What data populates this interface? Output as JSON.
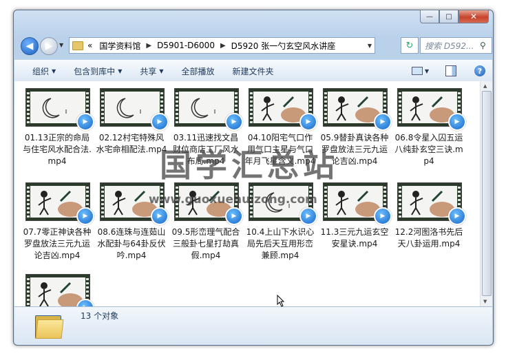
{
  "window": {
    "buttons": {
      "minimize": "—",
      "maximize": "□",
      "close": "✕"
    }
  },
  "nav": {
    "back_icon": "back-arrow-icon",
    "forward_icon": "forward-arrow-icon",
    "breadcrumb_prefix": "«",
    "breadcrumb": [
      "国学资料馆",
      "D5901-D6000",
      "D5920 张一勺玄空风水讲座"
    ],
    "search_placeholder": "搜索 D592..."
  },
  "toolbar": {
    "organize": "组织",
    "include_in_library": "包含到库中",
    "share": "共享",
    "play_all": "全部播放",
    "new_folder": "新建文件夹"
  },
  "files": [
    {
      "name": "01.13正宗的命局与住宅风水配合法.mp4",
      "thumb": "moon"
    },
    {
      "name": "02.12村宅特殊风水宅命相配法.mp4",
      "thumb": "moon"
    },
    {
      "name": "03.11迅速找文昌财位商店工厂风水布局.mp4",
      "thumb": "moon"
    },
    {
      "name": "04.10阳宅气口作用气口主星与气口年月飞星含义.mp4",
      "thumb": "hand"
    },
    {
      "name": "05.9替卦真诀各种罗盘放法三元九运论吉凶.mp4",
      "thumb": "hand"
    },
    {
      "name": "06.8令星入囚五运八纯卦玄空三诀.mp4",
      "thumb": "hand"
    },
    {
      "name": "07.7零正神诀各种罗盘放法三元九运论吉凶.mp4",
      "thumb": "hand"
    },
    {
      "name": "08.6连珠与连茹山水配卦与64卦反伏吟.mp4",
      "thumb": "hand"
    },
    {
      "name": "09.5形峦理气配合三般卦七星打劫真假.mp4",
      "thumb": "hand"
    },
    {
      "name": "10.4上山下水识心局先后天互用形峦兼顾.mp4",
      "thumb": "moon"
    },
    {
      "name": "11.3三元九运玄空安星诀.mp4",
      "thumb": "hand"
    },
    {
      "name": "12.2河图洛书先后天八卦运用.mp4",
      "thumb": "hand"
    },
    {
      "name": "",
      "thumb": "hand"
    }
  ],
  "status": {
    "count_text": "13 个对象"
  },
  "watermark": {
    "text": "国学汇总站",
    "url": "www.guoxuehuizong.com"
  }
}
